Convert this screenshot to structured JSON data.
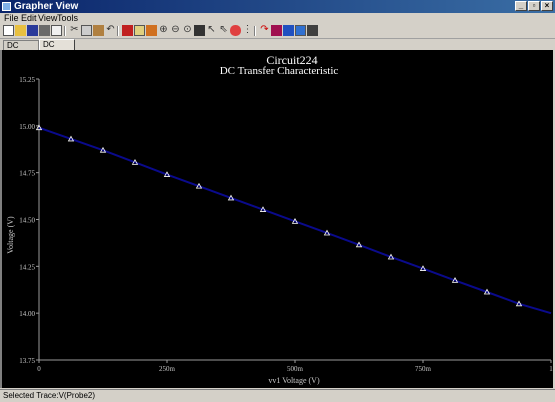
{
  "window": {
    "title": "Grapher View"
  },
  "menu": [
    "File",
    "Edit",
    "View",
    "Tools"
  ],
  "tabs": [
    {
      "label": "DC Sweep",
      "active": false
    },
    {
      "label": "DC Sweep",
      "active": true
    }
  ],
  "status": {
    "text": "Selected Trace:V(Probe2)"
  },
  "colors": {
    "plot_background": "#000000",
    "trace": "#0a0a8c",
    "markers": "#ffffff",
    "text": "#ffffff"
  },
  "chart_data": {
    "type": "line",
    "title": "Circuit224",
    "subtitle": "DC Transfer Characteristic",
    "xlabel": "vv1 Voltage (V)",
    "ylabel": "Voltage (V)",
    "xlim": [
      0,
      1
    ],
    "ylim": [
      13.75,
      15.25
    ],
    "x_ticks": [
      0,
      0.25,
      0.5,
      0.75,
      1.0
    ],
    "x_tick_labels": [
      "0",
      "250m",
      "500m",
      "750m",
      "1"
    ],
    "y_ticks": [
      13.75,
      14.0,
      14.25,
      14.5,
      14.75,
      15.0,
      15.25
    ],
    "y_tick_labels": [
      "13.75",
      "14.00",
      "14.25",
      "14.50",
      "14.75",
      "15.00",
      "15.25"
    ],
    "grid": false,
    "series": [
      {
        "name": "V(Probe2)",
        "x": [
          0,
          0.0625,
          0.125,
          0.1875,
          0.25,
          0.3125,
          0.375,
          0.4375,
          0.5,
          0.5625,
          0.625,
          0.6875,
          0.75,
          0.8125,
          0.875,
          0.9375,
          1.0
        ],
        "y": [
          14.99,
          14.93,
          14.87,
          14.805,
          14.74,
          14.678,
          14.615,
          14.553,
          14.49,
          14.428,
          14.365,
          14.3,
          14.238,
          14.175,
          14.113,
          14.05,
          14.0
        ],
        "markers": [
          true,
          true,
          true,
          true,
          true,
          true,
          true,
          true,
          true,
          true,
          true,
          true,
          true,
          true,
          true,
          true,
          false
        ]
      }
    ]
  }
}
